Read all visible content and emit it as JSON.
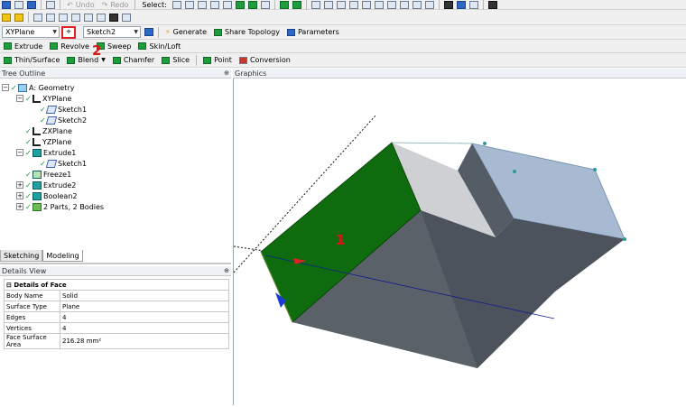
{
  "toolbar_row1": {
    "select_label": "Select:",
    "undo_label": "Undo",
    "redo_label": "Redo"
  },
  "toolbar_row3": {
    "plane_dropdown": "XYPlane",
    "sketch_dropdown": "Sketch2",
    "generate_label": "Generate",
    "share_topology_label": "Share Topology",
    "parameters_label": "Parameters"
  },
  "toolbar_row4": {
    "extrude_label": "Extrude",
    "revolve_label": "Revolve",
    "sweep_label": "Sweep",
    "skinloft_label": "Skin/Loft"
  },
  "toolbar_row5": {
    "thinsurface_label": "Thin/Surface",
    "blend_label": "Blend",
    "chamfer_label": "Chamfer",
    "slice_label": "Slice",
    "point_label": "Point",
    "conversion_label": "Conversion"
  },
  "tree_outline": {
    "title": "Tree Outline",
    "items": [
      {
        "label": "A: Geometry",
        "icon": "geometry-icon"
      },
      {
        "label": "XYPlane",
        "icon": "plane-icon"
      },
      {
        "label": "Sketch1",
        "icon": "sketch-icon"
      },
      {
        "label": "Sketch2",
        "icon": "sketch-icon"
      },
      {
        "label": "ZXPlane",
        "icon": "plane-icon"
      },
      {
        "label": "YZPlane",
        "icon": "plane-icon"
      },
      {
        "label": "Extrude1",
        "icon": "extrude-icon"
      },
      {
        "label": "Sketch1",
        "icon": "sketch-icon"
      },
      {
        "label": "Freeze1",
        "icon": "freeze-icon"
      },
      {
        "label": "Extrude2",
        "icon": "extrude-icon"
      },
      {
        "label": "Boolean2",
        "icon": "boolean-icon"
      },
      {
        "label": "2 Parts, 2 Bodies",
        "icon": "parts-icon"
      }
    ]
  },
  "tabs": {
    "sketching": "Sketching",
    "modeling": "Modeling"
  },
  "details_view": {
    "title": "Details View",
    "header": "Details of Face",
    "rows": [
      {
        "name": "Body Name",
        "value": "Solid"
      },
      {
        "name": "Surface Type",
        "value": "Plane"
      },
      {
        "name": "Edges",
        "value": "4"
      },
      {
        "name": "Vertices",
        "value": "4"
      },
      {
        "name": "Face Surface Area",
        "value": "216.28 mm²"
      }
    ]
  },
  "graphics": {
    "title": "Graphics"
  },
  "annotations": {
    "callout_1": "1",
    "callout_2": "2"
  },
  "colors": {
    "selected_face": "#0e6b0e",
    "highlight_box": "#e02020",
    "callout": "#d91515"
  }
}
